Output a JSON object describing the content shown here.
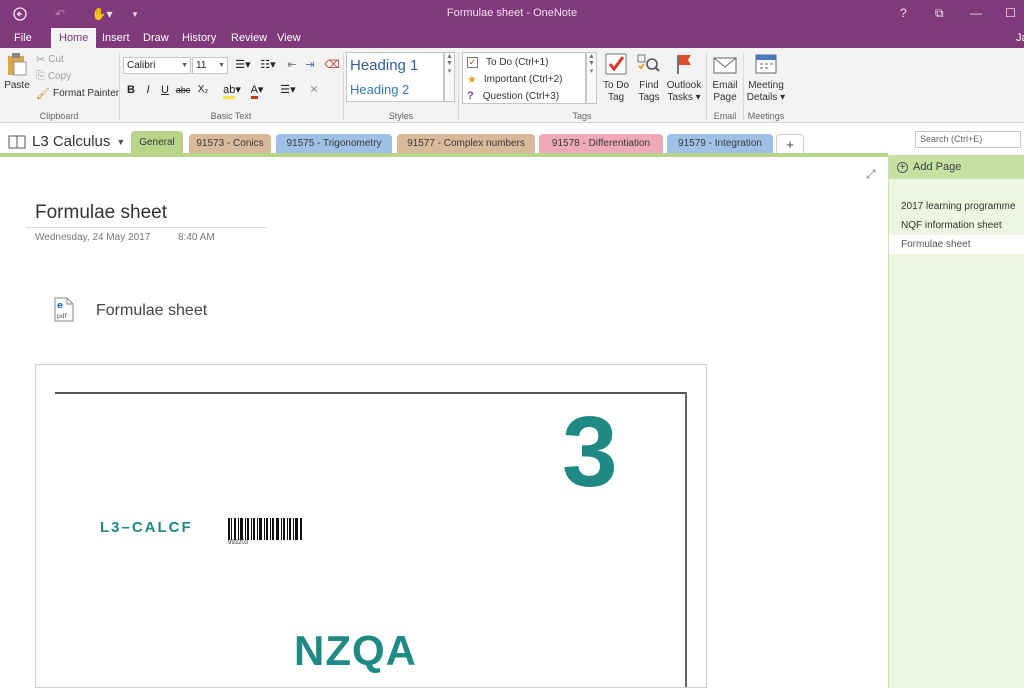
{
  "window": {
    "title": "Formulae sheet - OneNote",
    "help": "?",
    "user_initial": "Ja"
  },
  "ribbon_tabs": [
    "File",
    "Home",
    "Insert",
    "Draw",
    "History",
    "Review",
    "View"
  ],
  "clipboard": {
    "paste": "Paste",
    "cut": "Cut",
    "copy": "Copy",
    "format_painter": "Format Painter",
    "group": "Clipboard"
  },
  "basic_text": {
    "font": "Calibri",
    "size": "11",
    "bold": "B",
    "italic": "I",
    "underline": "U",
    "strike": "abc",
    "subscript": "X₂",
    "group": "Basic Text"
  },
  "styles": {
    "heading1": "Heading 1",
    "heading2": "Heading 2",
    "group": "Styles"
  },
  "tags": {
    "items": [
      "To Do (Ctrl+1)",
      "Important (Ctrl+2)",
      "Question (Ctrl+3)"
    ],
    "todo_tag": [
      "To Do",
      "Tag"
    ],
    "find_tags": [
      "Find",
      "Tags"
    ],
    "outlook_tasks": [
      "Outlook",
      "Tasks"
    ],
    "group": "Tags"
  },
  "email": {
    "label": [
      "Email",
      "Page"
    ],
    "group": "Email"
  },
  "meetings": {
    "label": [
      "Meeting",
      "Details"
    ],
    "group": "Meetings"
  },
  "notebook": {
    "name": "L3 Calculus"
  },
  "sections": [
    {
      "label": "General",
      "color": "#b8d48a"
    },
    {
      "label": "91573 - Conics",
      "color": "#d8b99a"
    },
    {
      "label": "91575 - Trigonometry",
      "color": "#9fc1e8"
    },
    {
      "label": "91577 - Complex numbers",
      "color": "#d8b99a"
    },
    {
      "label": "91578 - Differentiation",
      "color": "#efaab7"
    },
    {
      "label": "91579 - Integration",
      "color": "#9fc1e8"
    },
    {
      "label": "+",
      "color": "#ffffff"
    }
  ],
  "search": {
    "placeholder": "Search (Ctrl+E)"
  },
  "pages_pane": {
    "add_page": "Add Page",
    "pages": [
      "2017 learning programme",
      "NQF information sheet",
      "Formulae sheet"
    ],
    "active_index": 2
  },
  "page": {
    "title": "Formulae sheet",
    "date": "Wednesday, 24 May 2017",
    "time": "8:40 AM",
    "attachment_label": "Formulae sheet",
    "attachment_type": "pdf"
  },
  "printout": {
    "level": "3",
    "code": "L3–CALCF",
    "barcode_number": "993203",
    "logo": "NZQA"
  },
  "colors": {
    "brand": "#80397b",
    "section_accent": "#b8d48a",
    "nzqa_teal": "#1f8a83"
  }
}
